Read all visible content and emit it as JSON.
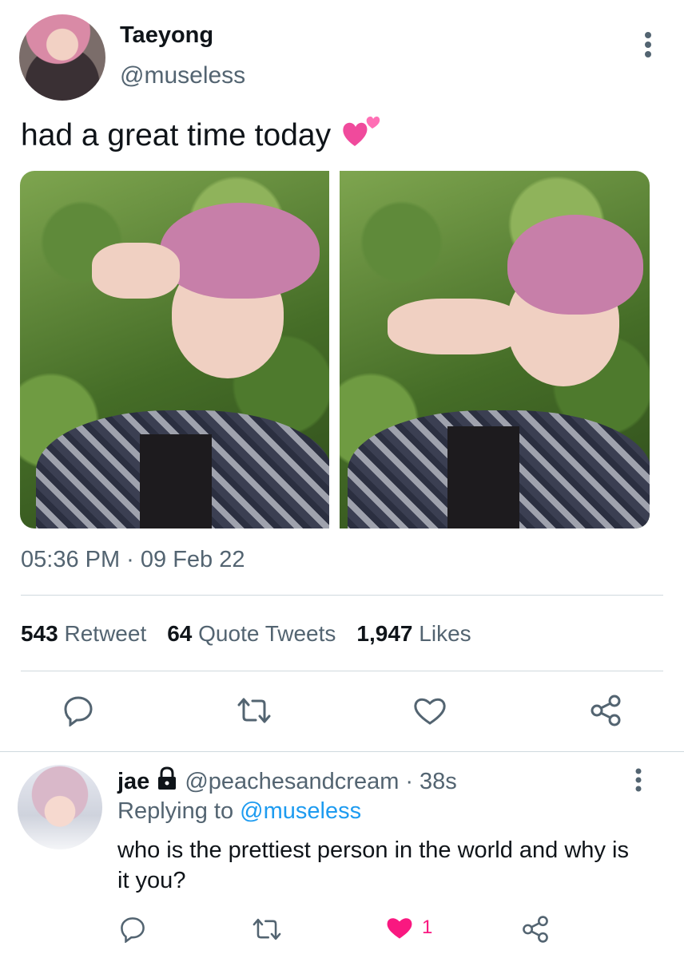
{
  "tweet": {
    "author": {
      "display_name": "Taeyong",
      "handle": "@museless",
      "avatar_icon": "profile-photo"
    },
    "text": "had a great time today",
    "emoji": "two-hearts-icon",
    "photos": [
      {
        "name": "selfie-photo-1"
      },
      {
        "name": "selfie-photo-2"
      }
    ],
    "timestamp": "05:36 PM · 09 Feb 22",
    "stats": {
      "retweets_count": "543",
      "retweets_label": "Retweet",
      "quotes_count": "64",
      "quotes_label": "Quote Tweets",
      "likes_count": "1,947",
      "likes_label": "Likes"
    },
    "actions": [
      "reply-icon",
      "retweet-icon",
      "like-icon",
      "share-icon"
    ]
  },
  "reply": {
    "author": {
      "display_name": "jae",
      "handle": "@peachesandcream",
      "time": "38s",
      "avatar_icon": "profile-photo"
    },
    "replying_prefix": "Replying to",
    "replying_to": "@museless",
    "text": "who is the prettiest person in the world and why is it you?",
    "like_count": "1"
  },
  "colors": {
    "text_primary": "#0f1419",
    "text_secondary": "#536471",
    "link": "#1d9bf0",
    "like_active": "#f91880",
    "divider": "#cfd9de"
  }
}
